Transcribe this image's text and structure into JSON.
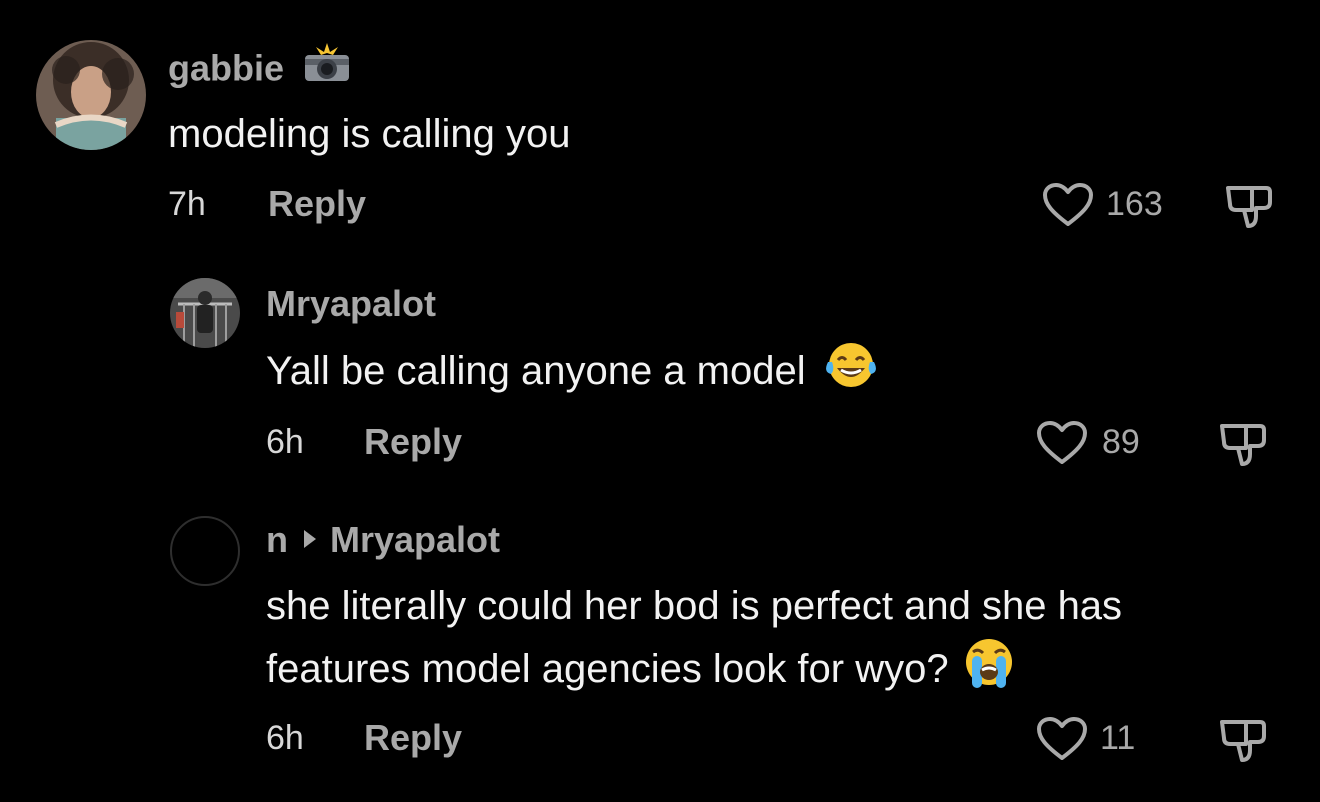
{
  "comments": [
    {
      "username": "gabbie",
      "username_icon": "camera-flash-icon",
      "text": "modeling is calling you",
      "time": "7h",
      "reply_label": "Reply",
      "likes": "163"
    },
    {
      "username": "Mryapalot",
      "text": "Yall be calling anyone a model",
      "text_emoji": "tears-of-joy-emoji",
      "time": "6h",
      "reply_label": "Reply",
      "likes": "89"
    },
    {
      "username": "n",
      "reply_to": "Mryapalot",
      "text_line1": "she literally could her bod is perfect and she has",
      "text_line2": "features model agencies look for wyo?",
      "text_emoji": "loudly-crying-emoji",
      "time": "6h",
      "reply_label": "Reply",
      "likes": "11"
    }
  ],
  "colors": {
    "background": "#000000",
    "username": "#a9a9a9",
    "text": "#f2f2f2",
    "emoji_yellow": "#f7c62f"
  }
}
